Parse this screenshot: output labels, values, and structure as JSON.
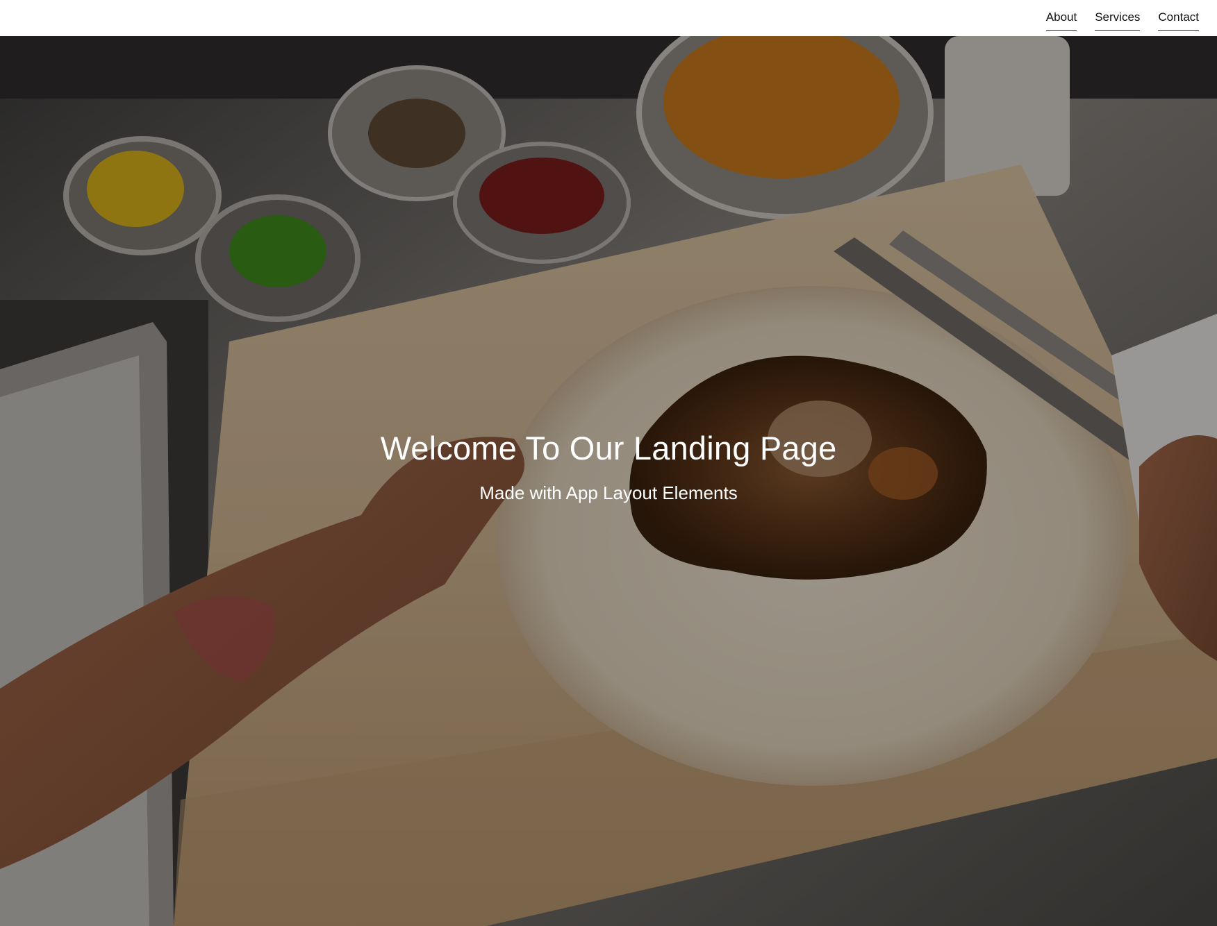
{
  "nav": {
    "items": [
      {
        "label": "About"
      },
      {
        "label": "Services"
      },
      {
        "label": "Contact"
      }
    ]
  },
  "hero": {
    "title": "Welcome To Our Landing Page",
    "subtitle": "Made with App Layout Elements",
    "background_image": "photo of hands filling a tortilla with meat on a wooden cutting board, with bowls of lemon, lime, chili and onions",
    "overlay_color": "#000000"
  }
}
